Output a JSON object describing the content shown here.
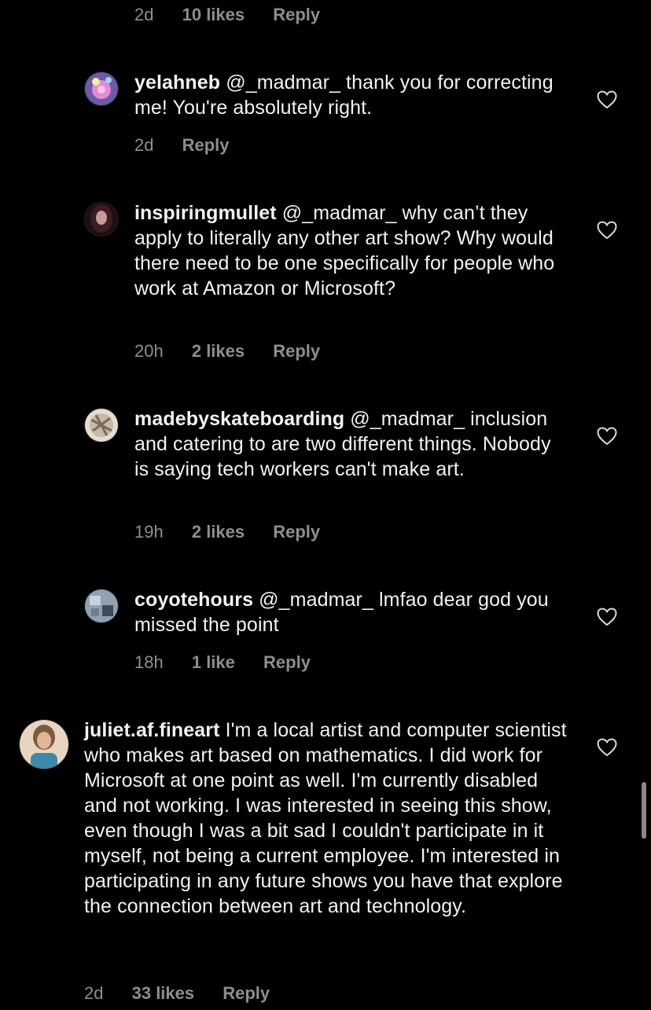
{
  "top_meta": {
    "time": "2d",
    "likes": "10 likes",
    "reply": "Reply"
  },
  "comments": [
    {
      "user": "yelahneb",
      "text": " @_madmar_ thank you for correcting me! You're absolutely right.",
      "time": "2d",
      "likes": "",
      "reply": "Reply",
      "avatar_colors": [
        "#6b5aa6",
        "#e28ad8",
        "#f6f0a0"
      ]
    },
    {
      "user": "inspiringmullet",
      "text": " @_madmar_ why can’t they apply to literally any other art show? Why would there need to be one specifically for people who work at Amazon or Microsoft?",
      "time": "20h",
      "likes": "2 likes",
      "reply": "Reply",
      "avatar_colors": [
        "#3a1c22",
        "#c59a9a",
        "#1b0f12"
      ]
    },
    {
      "user": "madebyskateboarding",
      "text": " @_madmar_ inclusion and catering to are two different things. Nobody is saying tech workers can't make art.",
      "time": "19h",
      "likes": "2 likes",
      "reply": "Reply",
      "avatar_colors": [
        "#c9b8a4",
        "#7a6a5c",
        "#e6ddd0"
      ]
    },
    {
      "user": "coyotehours",
      "text": " @_madmar_ lmfao dear god you missed the point",
      "time": "18h",
      "likes": "1 like",
      "reply": "Reply",
      "avatar_colors": [
        "#8fa2b4",
        "#3e4a55",
        "#c8d2da"
      ]
    },
    {
      "user": "juliet.af.fineart",
      "text": " I'm a local artist and computer scientist who makes art based on mathematics. I did work for Microsoft at one point as well. I'm currently disabled and not working. I was interested in seeing this show, even though I was a bit sad I couldn't participate in it myself, not being a current employee. I'm interested in participating in any future shows you have that explore the connection between art and technology.",
      "time": "2d",
      "likes": "33 likes",
      "reply": "Reply",
      "avatar_colors": [
        "#7b5a3e",
        "#3a8aa8",
        "#e8d5c0"
      ]
    }
  ],
  "icons": {
    "like": "heart-outline-icon"
  }
}
